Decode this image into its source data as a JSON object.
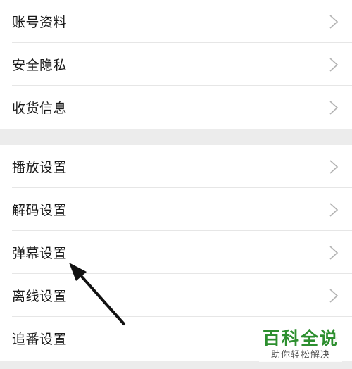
{
  "settings": {
    "group1": [
      {
        "label": "账号资料"
      },
      {
        "label": "安全隐私"
      },
      {
        "label": "收货信息"
      }
    ],
    "group2": [
      {
        "label": "播放设置"
      },
      {
        "label": "解码设置"
      },
      {
        "label": "弹幕设置"
      },
      {
        "label": "离线设置"
      },
      {
        "label": "追番设置"
      }
    ]
  },
  "icons": {
    "row_chevron": "chevron-right-icon",
    "annotation_arrow": "arrow-pointer-icon"
  },
  "watermark": {
    "title": "百科全说",
    "subtitle": "助你轻松解决"
  },
  "colors": {
    "watermark_green": "#2d8f2f",
    "section_gap": "#ececec",
    "chevron": "#b3b3b3"
  }
}
